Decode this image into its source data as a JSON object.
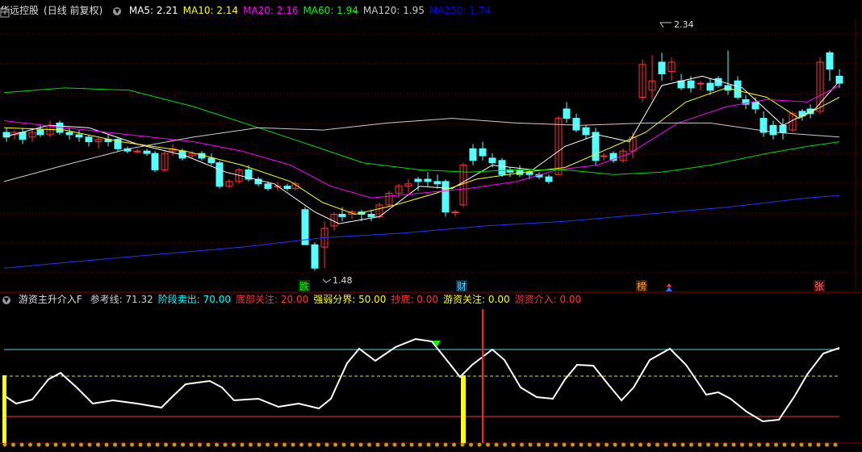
{
  "stock": {
    "name": "华远控股",
    "period_label": "(日线 前复权)"
  },
  "ma_legend": [
    {
      "label": "MA5: 2.21",
      "color": "#ffffff"
    },
    {
      "label": "MA10: 2.14",
      "color": "#ffff00"
    },
    {
      "label": "MA20: 2.16",
      "color": "#ff00ff"
    },
    {
      "label": "MA60: 1.94",
      "color": "#00ff00"
    },
    {
      "label": "MA120: 1.95",
      "color": "#cccccc"
    },
    {
      "label": "MA250: 1.74",
      "color": "#0000ff"
    }
  ],
  "price_marks": {
    "high": "2.34",
    "low": "1.48"
  },
  "event_labels": [
    {
      "text": "跌",
      "color": "#00ff00",
      "bg": "#004400"
    },
    {
      "text": "财",
      "color": "#44ddff",
      "bg": "#003355"
    },
    {
      "text": "榜",
      "color": "#ff9933",
      "bg": "#442200"
    },
    {
      "text": "张",
      "color": "#ff6666",
      "bg": "#441111"
    }
  ],
  "indicator": {
    "name": "游资主升介入F",
    "items": [
      {
        "label": "参考线: 71.32",
        "color": "#cccccc"
      },
      {
        "label": "阶段卖出: 70.00",
        "color": "#00ffff"
      },
      {
        "label": "底部关注: 20.00",
        "color": "#ff3333"
      },
      {
        "label": "强弱分界: 50.00",
        "color": "#ffff00"
      },
      {
        "label": "抄底: 0.00",
        "color": "#ff3333"
      },
      {
        "label": "游资关注: 0.00",
        "color": "#ffff00"
      },
      {
        "label": "游资介入: 0.00",
        "color": "#ff3333"
      }
    ]
  },
  "colors": {
    "up": "#ff3333",
    "down": "#54ffff",
    "grid": "#7a0000"
  }
}
